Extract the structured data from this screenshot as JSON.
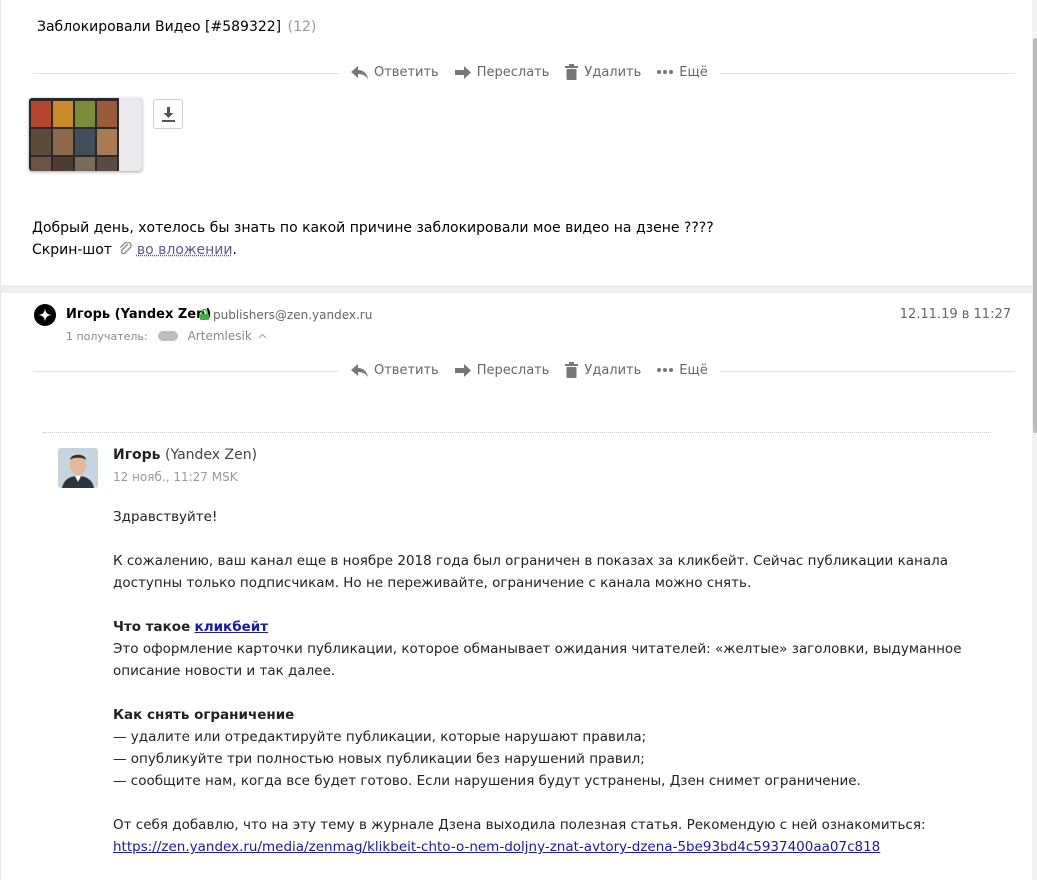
{
  "subject": {
    "title": "Заблокировали Видео [#589322]",
    "count": "(12)"
  },
  "toolbar": {
    "reply": "Ответить",
    "forward": "Переслать",
    "delete": "Удалить",
    "more": "Ещё"
  },
  "first_message": {
    "line1": "Добрый день, хотелось бы знать по какой причине заблокировали мое видео на дзене ????",
    "line2_prefix": "Скрин-шот",
    "attachment_link": "во вложении",
    "line2_suffix": "."
  },
  "reply_header": {
    "sender_name": "Игорь (Yandex Zen)",
    "sender_email": "publishers@zen.yandex.ru",
    "date": "12.11.19 в 11:27",
    "recipients_label": "1 получатель:",
    "recipient_name": "Artemlesik"
  },
  "reply_body": {
    "author_name": "Игорь",
    "author_org": "(Yandex Zen)",
    "meta": "12 нояб., 11:27 MSK",
    "greeting": "Здравствуйте!",
    "para1": "К сожалению, ваш канал еще в ноябре 2018 года был ограничен в показах за кликбейт. Сейчас публикации канала доступны только подписчикам. Но не переживайте, ограничение с канала можно снять.",
    "what_is_heading": "Что такое",
    "what_is_link": "кликбейт",
    "what_is_text": "Это оформление карточки публикации, которое обманывает ожидания читателей: «желтые» заголовки, выдуманное описание новости и так далее.",
    "how_heading": "Как снять ограничение",
    "steps": [
      "— удалите или отредактируйте публикации, которые нарушают правила;",
      "— опубликуйте три полностью новых публикации без нарушений правил;",
      "— сообщите нам, когда все будет готово. Если нарушения будут устранены, Дзен снимет ограничение."
    ],
    "closing": "От себя добавлю, что на эту тему в журнале Дзена выходила полезная статья. Рекомендую с ней ознакомиться:",
    "url": "https://zen.yandex.ru/media/zenmag/klikbeit-chto-o-nem-doljny-znat-avtory-dzena-5be93bd4c5937400aa07c818"
  },
  "icons": [
    "reply-icon",
    "forward-icon",
    "trash-icon",
    "more-icon",
    "download-icon",
    "paperclip-icon",
    "lock-icon",
    "zen-logo-icon",
    "chevron-up-icon"
  ],
  "colors": {
    "link": "#1a1aa6",
    "muted": "#666666",
    "lock": "#3cb043"
  }
}
